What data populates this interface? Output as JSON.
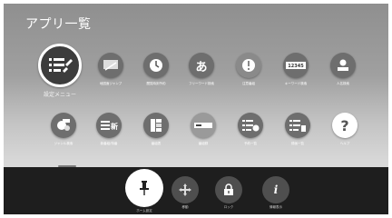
{
  "header": {
    "title": "アプリ一覧"
  },
  "apps": [
    {
      "label": "設定メニュー",
      "icon": "settings-menu-icon",
      "glyph": "☰"
    },
    {
      "label": "地図面ジャンプ",
      "icon": "map-jump-icon",
      "glyph": "▭"
    },
    {
      "label": "閲覧時刻予約",
      "icon": "clock-icon",
      "glyph": "◷"
    },
    {
      "label": "フリーワード検索",
      "icon": "keyword-search-icon",
      "glyph": "あ"
    },
    {
      "label": "注意番組",
      "icon": "alert-icon",
      "glyph": "!"
    },
    {
      "label": "キーワード検索",
      "icon": "number-search-icon",
      "glyph": "12345"
    },
    {
      "label": "人名検索",
      "icon": "person-search-icon",
      "glyph": "●"
    },
    {
      "label": "ジャンル検索",
      "icon": "genre-search-icon",
      "glyph": "●"
    },
    {
      "label": "新番組/特番",
      "icon": "new-program-icon",
      "glyph": "新"
    },
    {
      "label": "番組表",
      "icon": "guide-icon",
      "glyph": "▤"
    },
    {
      "label": "番組録",
      "icon": "recording-icon",
      "glyph": "▬"
    },
    {
      "label": "予約一覧",
      "icon": "reservation-list-icon",
      "glyph": "☰"
    },
    {
      "label": "録画一覧",
      "icon": "recorded-list-icon",
      "glyph": "≣"
    },
    {
      "label": "ヘルプ",
      "icon": "help-icon",
      "glyph": "?"
    }
  ],
  "bottom_bar": [
    {
      "label": "ホーム設定",
      "icon": "pin-icon",
      "glyph": "📌"
    },
    {
      "label": "移動",
      "icon": "move-icon",
      "glyph": "✥"
    },
    {
      "label": "ロック",
      "icon": "lock-icon",
      "glyph": "🔒"
    },
    {
      "label": "情報表示",
      "icon": "info-icon",
      "glyph": "i"
    }
  ]
}
